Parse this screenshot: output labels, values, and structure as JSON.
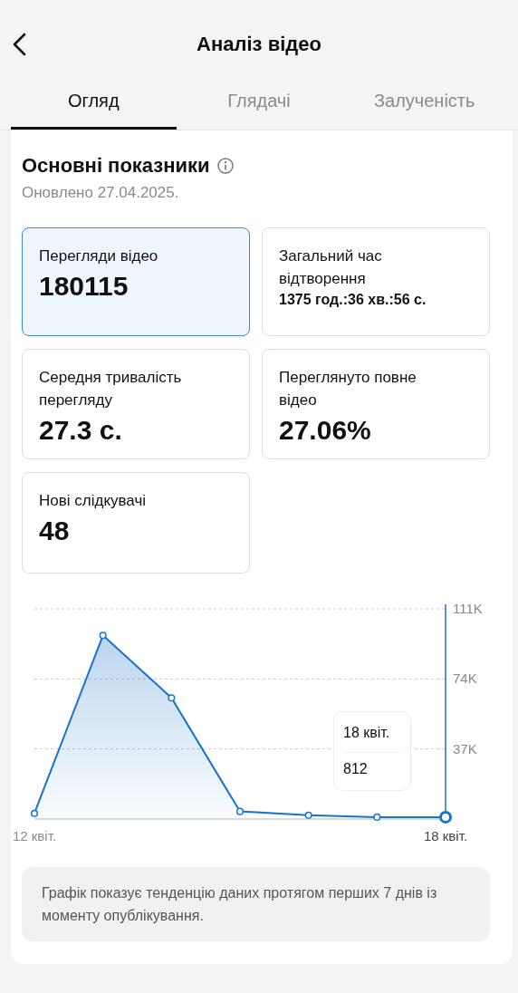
{
  "header": {
    "title": "Аналіз відео"
  },
  "tabs": [
    {
      "label": "Огляд",
      "selected": true
    },
    {
      "label": "Глядачі",
      "selected": false
    },
    {
      "label": "Залученість",
      "selected": false
    }
  ],
  "section": {
    "title": "Основні показники",
    "updated": "Оновлено 27.04.2025."
  },
  "metrics": [
    {
      "label": "Перегляди відео",
      "value": "180115",
      "selected": true,
      "kind": "large"
    },
    {
      "label": "Загальний час відтворення",
      "value": "1375 год.:36 хв.:56 с.",
      "selected": false,
      "kind": "small"
    },
    {
      "label": "Середня тривалість перегляду",
      "value": "27.3 с.",
      "selected": false,
      "kind": "large"
    },
    {
      "label": "Переглянуто повне відео",
      "value": "27.06%",
      "selected": false,
      "kind": "large"
    },
    {
      "label": "Нові слідкувачі",
      "value": "48",
      "selected": false,
      "kind": "large"
    }
  ],
  "chart": {
    "chart_data": {
      "type": "area",
      "categories": [
        "12 квіт.",
        null,
        null,
        null,
        null,
        null,
        "18 квіт."
      ],
      "series": [
        {
          "color": "#1a73c8",
          "values": [
            3000,
            97000,
            64000,
            4000,
            2000,
            1000,
            1000
          ]
        }
      ],
      "ylim": [
        0,
        111000
      ],
      "yticks": [
        {
          "value": 37000,
          "label": "37K"
        },
        {
          "value": 74000,
          "label": "74K"
        },
        {
          "value": 111000,
          "label": "111K"
        }
      ]
    },
    "points": [
      {
        "selected": false
      },
      {
        "selected": false
      },
      {
        "selected": false
      },
      {
        "selected": false
      },
      {
        "selected": false
      },
      {
        "selected": false
      },
      {
        "selected": true
      }
    ],
    "tooltip": {
      "date": "18 квіт.",
      "value": "812"
    }
  },
  "note": "Графік показує тенденцію даних протягом перших 7 днів із моменту опублікування."
}
